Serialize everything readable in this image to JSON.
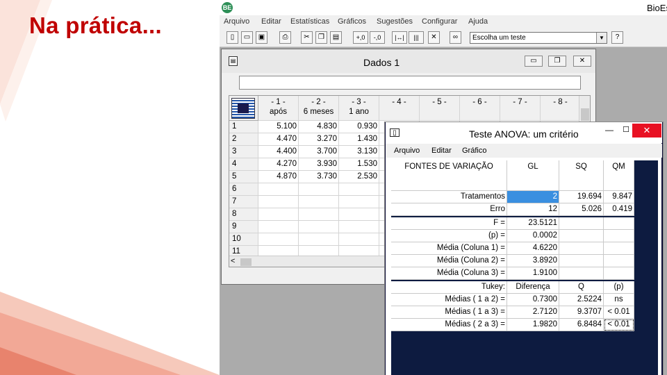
{
  "slide": {
    "title": "Na prática..."
  },
  "app": {
    "title": "BioEs",
    "logo": "BE",
    "menu": [
      "Arquivo",
      "Editar",
      "Estatísticas",
      "Gráficos",
      "Sugestões",
      "Configurar",
      "Ajuda"
    ],
    "toolbar": {
      "buttons": [
        {
          "icon": "new-file-icon",
          "glyph": "▯"
        },
        {
          "icon": "open-folder-icon",
          "glyph": "▭"
        },
        {
          "icon": "save-icon",
          "glyph": "▣"
        },
        {
          "icon": "print-icon",
          "glyph": "⎙"
        },
        {
          "icon": "cut-icon",
          "glyph": "✂"
        },
        {
          "icon": "copy-icon",
          "glyph": "❐"
        },
        {
          "icon": "paste-icon",
          "glyph": "▤"
        },
        {
          "icon": "increase-decimal-icon",
          "glyph": "+,0"
        },
        {
          "icon": "decrease-decimal-icon",
          "glyph": "-,0"
        },
        {
          "icon": "column-width-icon",
          "glyph": "|↔|"
        },
        {
          "icon": "column-split-icon",
          "glyph": "|||"
        },
        {
          "icon": "delete-icon",
          "glyph": "✕"
        },
        {
          "icon": "binoculars-icon",
          "glyph": "∞"
        },
        {
          "icon": "help-icon",
          "glyph": "?"
        }
      ],
      "test_select": {
        "value": "Escolha um teste",
        "arrow": "▼"
      }
    }
  },
  "dados": {
    "title": "Dados 1",
    "icon": "▤",
    "controls": {
      "minimize": "▭",
      "restore": "❐",
      "close": "✕"
    },
    "columns": [
      {
        "num": "- 1 -",
        "label": "após"
      },
      {
        "num": "- 2 -",
        "label": "6 meses"
      },
      {
        "num": "- 3 -",
        "label": "1 ano"
      },
      {
        "num": "- 4 -",
        "label": ""
      },
      {
        "num": "- 5 -",
        "label": ""
      },
      {
        "num": "- 6 -",
        "label": ""
      },
      {
        "num": "- 7 -",
        "label": ""
      },
      {
        "num": "- 8 -",
        "label": ""
      }
    ],
    "rows": [
      {
        "n": "1",
        "values": [
          "5.100",
          "4.830",
          "0.930"
        ]
      },
      {
        "n": "2",
        "values": [
          "4.470",
          "3.270",
          "1.430"
        ]
      },
      {
        "n": "3",
        "values": [
          "4.400",
          "3.700",
          "3.130"
        ]
      },
      {
        "n": "4",
        "values": [
          "4.270",
          "3.930",
          "1.530"
        ]
      },
      {
        "n": "5",
        "values": [
          "4.870",
          "3.730",
          "2.530"
        ]
      },
      {
        "n": "6",
        "values": [
          "",
          "",
          ""
        ]
      },
      {
        "n": "7",
        "values": [
          "",
          "",
          ""
        ]
      },
      {
        "n": "8",
        "values": [
          "",
          "",
          ""
        ]
      },
      {
        "n": "9",
        "values": [
          "",
          "",
          ""
        ]
      },
      {
        "n": "10",
        "values": [
          "",
          "",
          ""
        ]
      },
      {
        "n": "11",
        "values": [
          "",
          "",
          ""
        ]
      },
      {
        "n": "12",
        "values": [
          "",
          "",
          ""
        ]
      }
    ],
    "scroll_left": "<"
  },
  "anova": {
    "title": "Teste ANOVA: um critério",
    "icon": "▯",
    "controls": {
      "minimize": "—",
      "maximize": "☐",
      "close": "✕"
    },
    "menu": [
      "Arquivo",
      "Editar",
      "Gráfico"
    ],
    "header": [
      "FONTES DE VARIAÇÃO",
      "GL",
      "SQ",
      "QM"
    ],
    "rows": [
      {
        "label": "Tratamentos",
        "gl": "2",
        "sq": "19.694",
        "qm": "9.847"
      },
      {
        "label": "Erro",
        "gl": "12",
        "sq": "5.026",
        "qm": "0.419"
      }
    ],
    "stats": [
      {
        "label": "F =",
        "value": "23.5121"
      },
      {
        "label": "(p) =",
        "value": "0.0002"
      },
      {
        "label": "Média (Coluna 1) =",
        "value": "4.6220"
      },
      {
        "label": "Média (Coluna 2) =",
        "value": "3.8920"
      },
      {
        "label": "Média (Coluna 3) =",
        "value": "1.9100"
      }
    ],
    "tukey": {
      "label": "Tukey:",
      "headers": [
        "Diferença",
        "Q",
        "(p)"
      ],
      "rows": [
        {
          "label": "Médias ( 1 a 2) =",
          "dif": "0.7300",
          "q": "2.5224",
          "p": "ns"
        },
        {
          "label": "Médias ( 1 a 3) =",
          "dif": "2.7120",
          "q": "9.3707",
          "p": "< 0.01"
        },
        {
          "label": "Médias ( 2 a 3) =",
          "dif": "1.9820",
          "q": "6.8484",
          "p": "< 0.01"
        }
      ]
    }
  }
}
